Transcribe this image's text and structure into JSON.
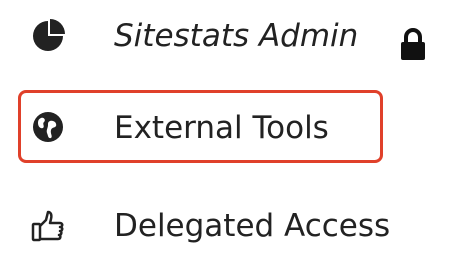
{
  "menu": {
    "items": [
      {
        "label": "Sitestats Admin",
        "icon": "pie-chart-icon",
        "locked": true,
        "lock_icon": "lock-icon"
      },
      {
        "label": "External Tools",
        "icon": "globe-icon",
        "highlighted": true
      },
      {
        "label": "Delegated Access",
        "icon": "thumbs-up-icon"
      }
    ]
  },
  "colors": {
    "text": "#222222",
    "highlight_border": "#e0402a",
    "background": "#ffffff"
  }
}
